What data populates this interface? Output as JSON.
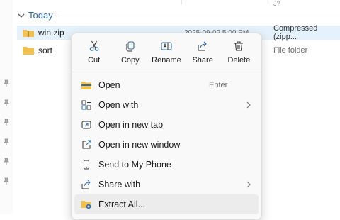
{
  "top_fragment": "J?",
  "group": {
    "label": "Today"
  },
  "files": [
    {
      "name": "win.zip",
      "date": "2025-09-02 5:00 PM",
      "type": "Compressed (zipp...",
      "selected": true
    },
    {
      "name": "sort",
      "date": "",
      "type": "File folder",
      "selected": false
    }
  ],
  "context_menu": {
    "quick_actions": [
      {
        "label": "Cut",
        "icon": "scissors-icon"
      },
      {
        "label": "Copy",
        "icon": "copy-icon"
      },
      {
        "label": "Rename",
        "icon": "rename-icon"
      },
      {
        "label": "Share",
        "icon": "share-icon"
      },
      {
        "label": "Delete",
        "icon": "trash-icon"
      }
    ],
    "items": [
      {
        "label": "Open",
        "icon": "open-folder-icon",
        "shortcut": "Enter",
        "submenu": false
      },
      {
        "label": "Open with",
        "icon": "open-with-icon",
        "shortcut": "",
        "submenu": true
      },
      {
        "label": "Open in new tab",
        "icon": "new-tab-icon",
        "shortcut": "",
        "submenu": false
      },
      {
        "label": "Open in new window",
        "icon": "new-window-icon",
        "shortcut": "",
        "submenu": false
      },
      {
        "label": "Send to My Phone",
        "icon": "phone-icon",
        "shortcut": "",
        "submenu": false
      },
      {
        "label": "Share with",
        "icon": "share-with-icon",
        "shortcut": "",
        "submenu": true
      },
      {
        "label": "Extract All...",
        "icon": "extract-all-icon",
        "shortcut": "",
        "submenu": false,
        "hovered": true
      }
    ]
  },
  "colors": {
    "accent": "#2b6cb0",
    "selection": "#e5f1fb",
    "folder": "#f2c14b"
  }
}
